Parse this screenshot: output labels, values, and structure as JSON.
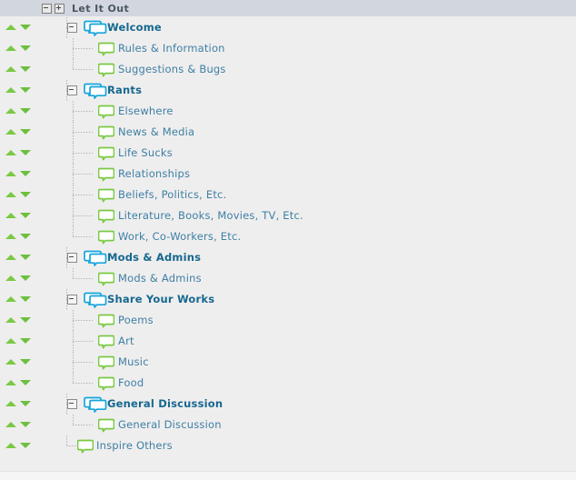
{
  "header": {
    "title": "Let It Out",
    "collapse_box_icon": "minus-box-icon",
    "expand_box_icon": "plus-box-icon"
  },
  "icons": {
    "sort_up": "sort-up-arrow-icon",
    "sort_down": "sort-down-arrow-icon",
    "category": "double-speech-bubble-icon",
    "forum": "single-speech-bubble-icon",
    "collapse": "minus-box-icon"
  },
  "colors": {
    "header_bg": "#d2d7df",
    "body_bg": "#efeeee",
    "category_text": "#15688f",
    "forum_text": "#3d7fa5",
    "category_icon": "#16a5dc",
    "forum_icon": "#7ac943",
    "sort_arrow": "#7ac943",
    "guide_line": "#b4b4b4"
  },
  "tree": [
    {
      "label": "Welcome",
      "type": "category",
      "level": 1,
      "collapsible": true,
      "last": false
    },
    {
      "label": "Rules & Information",
      "type": "forum",
      "level": 2,
      "collapsible": false,
      "last": false
    },
    {
      "label": "Suggestions & Bugs",
      "type": "forum",
      "level": 2,
      "collapsible": false,
      "last": true
    },
    {
      "label": "Rants",
      "type": "category",
      "level": 1,
      "collapsible": true,
      "last": false
    },
    {
      "label": "Elsewhere",
      "type": "forum",
      "level": 2,
      "collapsible": false,
      "last": false
    },
    {
      "label": "News & Media",
      "type": "forum",
      "level": 2,
      "collapsible": false,
      "last": false
    },
    {
      "label": "Life Sucks",
      "type": "forum",
      "level": 2,
      "collapsible": false,
      "last": false
    },
    {
      "label": "Relationships",
      "type": "forum",
      "level": 2,
      "collapsible": false,
      "last": false
    },
    {
      "label": "Beliefs, Politics, Etc.",
      "type": "forum",
      "level": 2,
      "collapsible": false,
      "last": false
    },
    {
      "label": "Literature, Books, Movies, TV, Etc.",
      "type": "forum",
      "level": 2,
      "collapsible": false,
      "last": false
    },
    {
      "label": "Work, Co-Workers, Etc.",
      "type": "forum",
      "level": 2,
      "collapsible": false,
      "last": true
    },
    {
      "label": "Mods & Admins",
      "type": "category",
      "level": 1,
      "collapsible": true,
      "last": false
    },
    {
      "label": "Mods & Admins",
      "type": "forum",
      "level": 2,
      "collapsible": false,
      "last": true
    },
    {
      "label": "Share Your Works",
      "type": "category",
      "level": 1,
      "collapsible": true,
      "last": false
    },
    {
      "label": "Poems",
      "type": "forum",
      "level": 2,
      "collapsible": false,
      "last": false
    },
    {
      "label": "Art",
      "type": "forum",
      "level": 2,
      "collapsible": false,
      "last": false
    },
    {
      "label": "Music",
      "type": "forum",
      "level": 2,
      "collapsible": false,
      "last": false
    },
    {
      "label": "Food",
      "type": "forum",
      "level": 2,
      "collapsible": false,
      "last": true
    },
    {
      "label": "General Discussion",
      "type": "category",
      "level": 1,
      "collapsible": true,
      "last": false
    },
    {
      "label": "General Discussion",
      "type": "forum",
      "level": 2,
      "collapsible": false,
      "last": true
    },
    {
      "label": "Inspire Others",
      "type": "forum",
      "level": 1,
      "collapsible": false,
      "last": true
    }
  ]
}
